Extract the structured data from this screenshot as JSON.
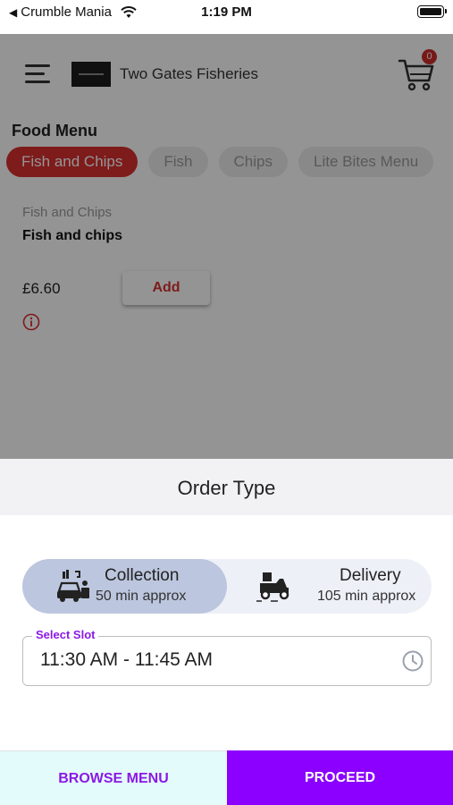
{
  "status_bar": {
    "back_app": "Crumble Mania",
    "time": "1:19 PM"
  },
  "header": {
    "store_name": "Two Gates Fisheries",
    "cart_count": "0"
  },
  "menu": {
    "title": "Food Menu",
    "categories": [
      "Fish and Chips",
      "Fish",
      "Chips",
      "Lite Bites Menu"
    ],
    "active_category": "Fish and Chips",
    "item": {
      "category": "Fish and Chips",
      "name": "Fish and chips",
      "price": "£6.60",
      "add_label": "Add"
    }
  },
  "order_sheet": {
    "title": "Order Type",
    "options": [
      {
        "label": "Collection",
        "time": "50 min approx",
        "icon": "car-pickup-icon",
        "selected": true
      },
      {
        "label": "Delivery",
        "time": "105 min approx",
        "icon": "delivery-scooter-icon",
        "selected": false
      }
    ],
    "slot": {
      "label": "Select Slot",
      "value": "11:30 AM - 11:45 AM",
      "icon": "clock-icon"
    },
    "buttons": {
      "browse": "BROWSE MENU",
      "proceed": "PROCEED"
    }
  },
  "colors": {
    "accent_red": "#d9302f",
    "accent_purple": "#8b00ff",
    "selected_option": "#bcc6de"
  }
}
